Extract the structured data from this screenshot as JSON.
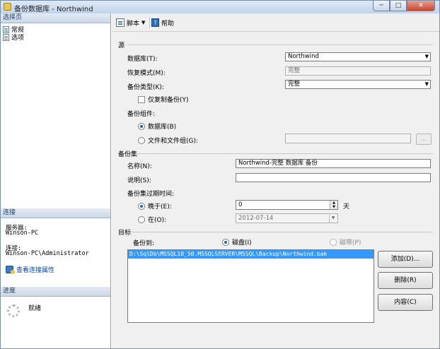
{
  "window": {
    "title": "备份数据库 - Northwind",
    "min_label": "─",
    "max_label": "□",
    "close_label": "✕"
  },
  "left": {
    "select_page_header": "选择页",
    "pages": [
      "常规",
      "选项"
    ],
    "connection_header": "连接",
    "server_label": "服务器:",
    "server_value": "Winson-PC",
    "connection_label": "连接:",
    "connection_value": "Winson-PC\\Administrator",
    "view_props_link": "查看连接属性",
    "progress_header": "进度",
    "status": "就绪"
  },
  "toolbar": {
    "script_label": "脚本",
    "help_label": "帮助"
  },
  "source": {
    "group": "源",
    "database_label": "数据库(T):",
    "database_value": "Northwind",
    "recovery_label": "恢复模式(M):",
    "recovery_value": "完整",
    "backup_type_label": "备份类型(K):",
    "backup_type_value": "完整",
    "copy_only_label": "仅复制备份(Y)",
    "component_label": "备份组件:",
    "radio_database": "数据库(B)",
    "radio_files": "文件和文件组(G):",
    "files_btn": "..."
  },
  "backup_set": {
    "group": "备份集",
    "name_label": "名称(N):",
    "name_value": "Northwind-完整 数据库 备份",
    "desc_label": "说明(S):",
    "desc_value": "",
    "expire_label": "备份集过期时间:",
    "after_label": "晚于(E):",
    "after_value": "0",
    "days_label": "天",
    "on_label": "在(O):",
    "on_value": "2012-07-14"
  },
  "destination": {
    "group": "目标",
    "backup_to_label": "备份到:",
    "disk_label": "磁盘(I)",
    "tape_label": "磁带(P)",
    "paths": [
      "D:\\SqlDb\\MSSQL10_50.MSSQLSERVER\\MSSQL\\Backup\\Northwind.bak"
    ],
    "add_label": "添加(D)...",
    "remove_label": "删除(R)",
    "contents_label": "内容(C)"
  }
}
